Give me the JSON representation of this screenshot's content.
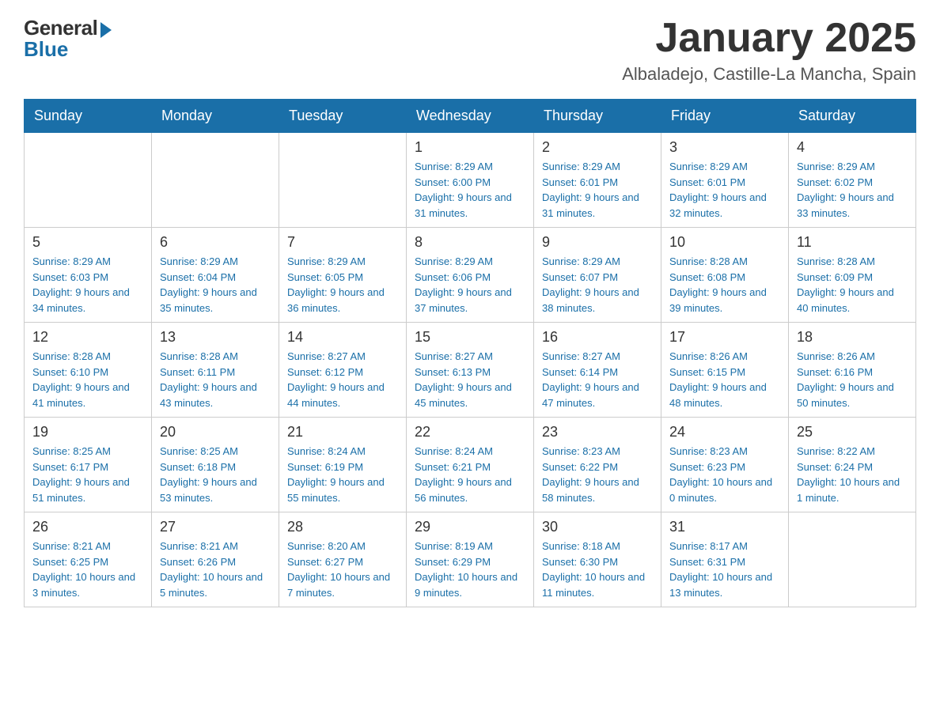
{
  "header": {
    "logo": {
      "general": "General",
      "blue": "Blue"
    },
    "title": "January 2025",
    "location": "Albaladejo, Castille-La Mancha, Spain"
  },
  "weekdays": [
    "Sunday",
    "Monday",
    "Tuesday",
    "Wednesday",
    "Thursday",
    "Friday",
    "Saturday"
  ],
  "weeks": [
    [
      {
        "day": "",
        "info": ""
      },
      {
        "day": "",
        "info": ""
      },
      {
        "day": "",
        "info": ""
      },
      {
        "day": "1",
        "info": "Sunrise: 8:29 AM\nSunset: 6:00 PM\nDaylight: 9 hours and 31 minutes."
      },
      {
        "day": "2",
        "info": "Sunrise: 8:29 AM\nSunset: 6:01 PM\nDaylight: 9 hours and 31 minutes."
      },
      {
        "day": "3",
        "info": "Sunrise: 8:29 AM\nSunset: 6:01 PM\nDaylight: 9 hours and 32 minutes."
      },
      {
        "day": "4",
        "info": "Sunrise: 8:29 AM\nSunset: 6:02 PM\nDaylight: 9 hours and 33 minutes."
      }
    ],
    [
      {
        "day": "5",
        "info": "Sunrise: 8:29 AM\nSunset: 6:03 PM\nDaylight: 9 hours and 34 minutes."
      },
      {
        "day": "6",
        "info": "Sunrise: 8:29 AM\nSunset: 6:04 PM\nDaylight: 9 hours and 35 minutes."
      },
      {
        "day": "7",
        "info": "Sunrise: 8:29 AM\nSunset: 6:05 PM\nDaylight: 9 hours and 36 minutes."
      },
      {
        "day": "8",
        "info": "Sunrise: 8:29 AM\nSunset: 6:06 PM\nDaylight: 9 hours and 37 minutes."
      },
      {
        "day": "9",
        "info": "Sunrise: 8:29 AM\nSunset: 6:07 PM\nDaylight: 9 hours and 38 minutes."
      },
      {
        "day": "10",
        "info": "Sunrise: 8:28 AM\nSunset: 6:08 PM\nDaylight: 9 hours and 39 minutes."
      },
      {
        "day": "11",
        "info": "Sunrise: 8:28 AM\nSunset: 6:09 PM\nDaylight: 9 hours and 40 minutes."
      }
    ],
    [
      {
        "day": "12",
        "info": "Sunrise: 8:28 AM\nSunset: 6:10 PM\nDaylight: 9 hours and 41 minutes."
      },
      {
        "day": "13",
        "info": "Sunrise: 8:28 AM\nSunset: 6:11 PM\nDaylight: 9 hours and 43 minutes."
      },
      {
        "day": "14",
        "info": "Sunrise: 8:27 AM\nSunset: 6:12 PM\nDaylight: 9 hours and 44 minutes."
      },
      {
        "day": "15",
        "info": "Sunrise: 8:27 AM\nSunset: 6:13 PM\nDaylight: 9 hours and 45 minutes."
      },
      {
        "day": "16",
        "info": "Sunrise: 8:27 AM\nSunset: 6:14 PM\nDaylight: 9 hours and 47 minutes."
      },
      {
        "day": "17",
        "info": "Sunrise: 8:26 AM\nSunset: 6:15 PM\nDaylight: 9 hours and 48 minutes."
      },
      {
        "day": "18",
        "info": "Sunrise: 8:26 AM\nSunset: 6:16 PM\nDaylight: 9 hours and 50 minutes."
      }
    ],
    [
      {
        "day": "19",
        "info": "Sunrise: 8:25 AM\nSunset: 6:17 PM\nDaylight: 9 hours and 51 minutes."
      },
      {
        "day": "20",
        "info": "Sunrise: 8:25 AM\nSunset: 6:18 PM\nDaylight: 9 hours and 53 minutes."
      },
      {
        "day": "21",
        "info": "Sunrise: 8:24 AM\nSunset: 6:19 PM\nDaylight: 9 hours and 55 minutes."
      },
      {
        "day": "22",
        "info": "Sunrise: 8:24 AM\nSunset: 6:21 PM\nDaylight: 9 hours and 56 minutes."
      },
      {
        "day": "23",
        "info": "Sunrise: 8:23 AM\nSunset: 6:22 PM\nDaylight: 9 hours and 58 minutes."
      },
      {
        "day": "24",
        "info": "Sunrise: 8:23 AM\nSunset: 6:23 PM\nDaylight: 10 hours and 0 minutes."
      },
      {
        "day": "25",
        "info": "Sunrise: 8:22 AM\nSunset: 6:24 PM\nDaylight: 10 hours and 1 minute."
      }
    ],
    [
      {
        "day": "26",
        "info": "Sunrise: 8:21 AM\nSunset: 6:25 PM\nDaylight: 10 hours and 3 minutes."
      },
      {
        "day": "27",
        "info": "Sunrise: 8:21 AM\nSunset: 6:26 PM\nDaylight: 10 hours and 5 minutes."
      },
      {
        "day": "28",
        "info": "Sunrise: 8:20 AM\nSunset: 6:27 PM\nDaylight: 10 hours and 7 minutes."
      },
      {
        "day": "29",
        "info": "Sunrise: 8:19 AM\nSunset: 6:29 PM\nDaylight: 10 hours and 9 minutes."
      },
      {
        "day": "30",
        "info": "Sunrise: 8:18 AM\nSunset: 6:30 PM\nDaylight: 10 hours and 11 minutes."
      },
      {
        "day": "31",
        "info": "Sunrise: 8:17 AM\nSunset: 6:31 PM\nDaylight: 10 hours and 13 minutes."
      },
      {
        "day": "",
        "info": ""
      }
    ]
  ]
}
